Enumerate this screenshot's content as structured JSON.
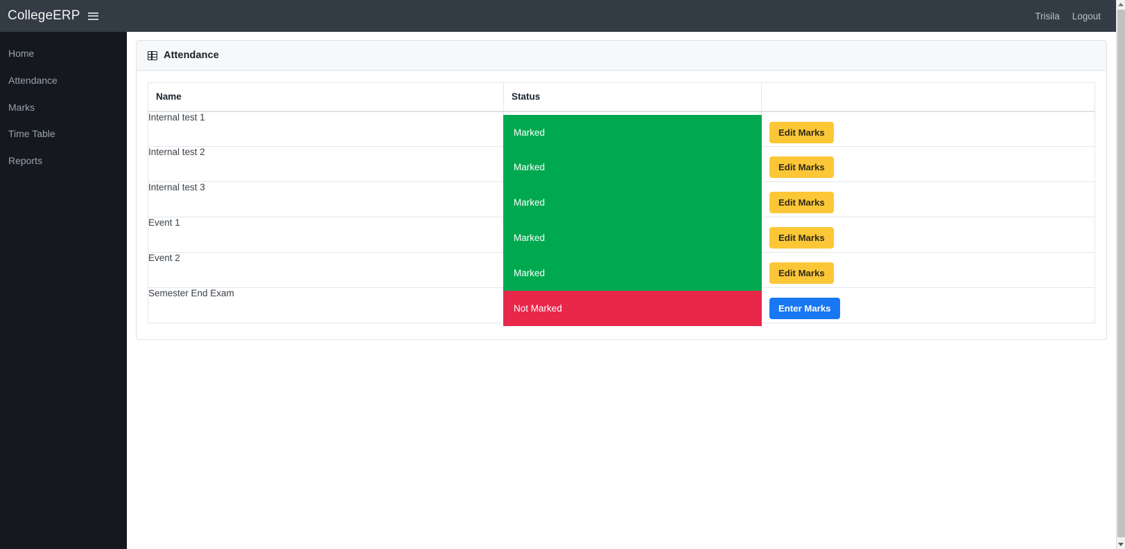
{
  "navbar": {
    "brand": "CollegeERP",
    "menu_icon": "hamburger-icon",
    "user": "Trisila",
    "logout": "Logout"
  },
  "sidebar": {
    "items": [
      {
        "label": "Home"
      },
      {
        "label": "Attendance"
      },
      {
        "label": "Marks"
      },
      {
        "label": "Time Table"
      },
      {
        "label": "Reports"
      }
    ]
  },
  "card": {
    "icon": "table-icon",
    "title": "Attendance"
  },
  "table": {
    "columns": [
      "Name",
      "Status",
      ""
    ],
    "rows": [
      {
        "name": "Internal test 1",
        "status": "Marked",
        "status_state": "marked",
        "action": "Edit Marks",
        "action_style": "edit"
      },
      {
        "name": "Internal test 2",
        "status": "Marked",
        "status_state": "marked",
        "action": "Edit Marks",
        "action_style": "edit"
      },
      {
        "name": "Internal test 3",
        "status": "Marked",
        "status_state": "marked",
        "action": "Edit Marks",
        "action_style": "edit"
      },
      {
        "name": "Event 1",
        "status": "Marked",
        "status_state": "marked",
        "action": "Edit Marks",
        "action_style": "edit"
      },
      {
        "name": "Event 2",
        "status": "Marked",
        "status_state": "marked",
        "action": "Edit Marks",
        "action_style": "edit"
      },
      {
        "name": "Semester End Exam",
        "status": "Not Marked",
        "status_state": "not-marked",
        "action": "Enter Marks",
        "action_style": "enter"
      }
    ]
  },
  "colors": {
    "navbar_bg": "#333b45",
    "sidebar_bg": "#15181e",
    "marked_green": "#00a94f",
    "not_marked_red": "#e8274b",
    "edit_button": "#fcc737",
    "enter_button": "#1877f2"
  },
  "scrollbar": {
    "up_arrow": "triangle-up-icon",
    "down_arrow": "triangle-down-icon"
  }
}
